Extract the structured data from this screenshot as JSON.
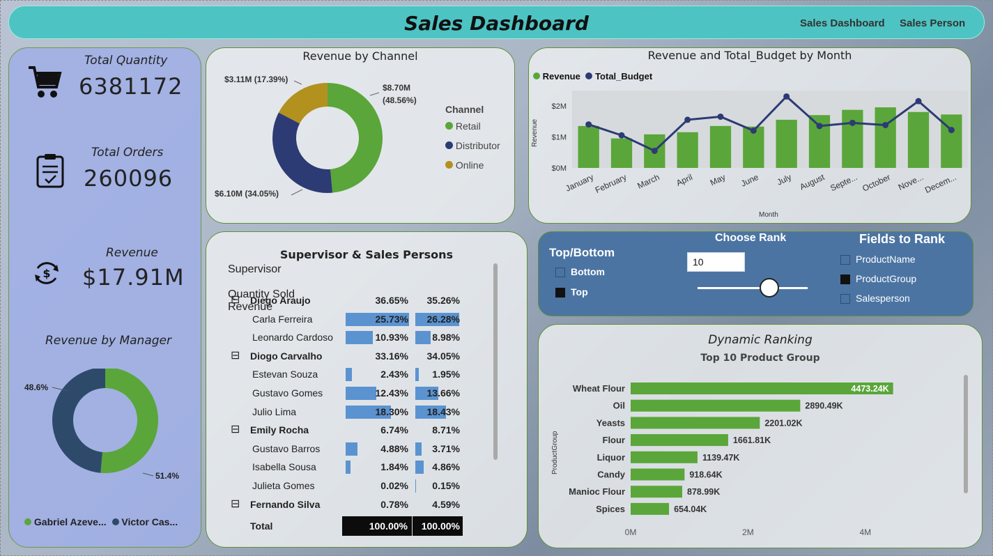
{
  "header": {
    "title": "Sales Dashboard",
    "nav": [
      "Sales Dashboard",
      "Sales Person"
    ]
  },
  "kpis": {
    "quantity_label": "Total Quantity",
    "quantity_value": "6381172",
    "orders_label": "Total Orders",
    "orders_value": "260096",
    "revenue_label": "Revenue",
    "revenue_value": "$17.91M"
  },
  "manager": {
    "title": "Revenue by Manager",
    "label_left": "48.6%",
    "label_right": "51.4%",
    "legend": [
      "Gabriel Azeve...",
      "Victor Cas..."
    ],
    "colors": [
      "#5aa63a",
      "#2e4a6b"
    ]
  },
  "channel": {
    "title": "Revenue by Channel",
    "legend_title": "Channel",
    "legend": [
      "Retail",
      "Distributor",
      "Online"
    ],
    "label_retail_1": "$8.70M",
    "label_retail_2": "(48.56%)",
    "label_distributor": "$6.10M (34.05%)",
    "label_online": "$3.11M (17.39%)",
    "colors": [
      "#5aa63a",
      "#2c3b74",
      "#b3911f"
    ]
  },
  "monthly": {
    "title": "Revenue and Total_Budget by Month",
    "legend": [
      "Revenue",
      "Total_Budget"
    ],
    "ylabel": "Revenue",
    "xlabel": "Month",
    "yticks": [
      "$2M",
      "$1M",
      "$0M"
    ],
    "months": [
      "January",
      "February",
      "March",
      "April",
      "May",
      "June",
      "July",
      "August",
      "Septe...",
      "October",
      "Nove...",
      "Decem..."
    ]
  },
  "table": {
    "title": "Supervisor & Sales Persons",
    "headers": [
      "Supervisor",
      "Quantity Sold",
      "Revenue"
    ],
    "rows": [
      {
        "name": "Diego Araujo",
        "qty": "36.65%",
        "rev": "35.26%",
        "group": true
      },
      {
        "name": "Carla Ferreira",
        "qty": "25.73%",
        "rev": "26.28%",
        "group": false
      },
      {
        "name": "Leonardo Cardoso",
        "qty": "10.93%",
        "rev": "8.98%",
        "group": false
      },
      {
        "name": "Diogo Carvalho",
        "qty": "33.16%",
        "rev": "34.05%",
        "group": true
      },
      {
        "name": "Estevan Souza",
        "qty": "2.43%",
        "rev": "1.95%",
        "group": false
      },
      {
        "name": "Gustavo Gomes",
        "qty": "12.43%",
        "rev": "13.66%",
        "group": false
      },
      {
        "name": "Julio Lima",
        "qty": "18.30%",
        "rev": "18.43%",
        "group": false
      },
      {
        "name": "Emily Rocha",
        "qty": "6.74%",
        "rev": "8.71%",
        "group": true
      },
      {
        "name": "Gustavo Barros",
        "qty": "4.88%",
        "rev": "3.71%",
        "group": false
      },
      {
        "name": "Isabella Sousa",
        "qty": "1.84%",
        "rev": "4.86%",
        "group": false
      },
      {
        "name": "Julieta Gomes",
        "qty": "0.02%",
        "rev": "0.15%",
        "group": false
      },
      {
        "name": "Fernando Silva",
        "qty": "0.78%",
        "rev": "4.59%",
        "group": true
      }
    ],
    "total_label": "Total",
    "total_qty": "100.00%",
    "total_rev": "100.00%",
    "expand_symbol": "⊟"
  },
  "rank": {
    "topbottom_title": "Top/Bottom",
    "opt_bottom": "Bottom",
    "opt_top": "Top",
    "choose_title": "Choose Rank",
    "rank_value": "10",
    "slider_fraction": 0.65,
    "fields_title": "Fields to Rank",
    "fields": [
      "ProductName",
      "ProductGroup",
      "Salesperson"
    ]
  },
  "ranking": {
    "title": "Dynamic Ranking",
    "subtitle": "Top 10 Product Group",
    "ylabel": "ProductGroup",
    "xticks": [
      "0M",
      "2M",
      "4M"
    ]
  },
  "chart_data": [
    {
      "type": "pie",
      "title": "Revenue by Manager",
      "categories": [
        "Gabriel Azeve...",
        "Victor Cas..."
      ],
      "values": [
        51.4,
        48.6
      ],
      "legend_position": "bottom"
    },
    {
      "type": "pie",
      "title": "Revenue by Channel",
      "categories": [
        "Retail",
        "Distributor",
        "Online"
      ],
      "values": [
        8.7,
        6.1,
        3.11
      ],
      "legend_position": "right"
    },
    {
      "type": "bar",
      "title": "Revenue and Total_Budget by Month",
      "categories": [
        "January",
        "February",
        "March",
        "April",
        "May",
        "June",
        "July",
        "August",
        "Septe...",
        "October",
        "Nove...",
        "Decem..."
      ],
      "series": [
        {
          "name": "Revenue",
          "type": "bar",
          "values": [
            1.35,
            0.95,
            1.08,
            1.15,
            1.35,
            1.33,
            1.55,
            1.7,
            1.87,
            1.95,
            1.8,
            1.72
          ]
        },
        {
          "name": "Total_Budget",
          "type": "line",
          "values": [
            1.4,
            1.05,
            0.55,
            1.55,
            1.65,
            1.2,
            2.3,
            1.35,
            1.45,
            1.38,
            2.15,
            1.22
          ]
        }
      ],
      "ylim": [
        0,
        2.4
      ],
      "xlabel": "Month",
      "ylabel": "Revenue",
      "legend_position": "top-left"
    },
    {
      "type": "bar",
      "orientation": "horizontal",
      "title": "Top 10 Product Group",
      "categories": [
        "Wheat Flour",
        "Oil",
        "Yeasts",
        "Flour",
        "Liquor",
        "Candy",
        "Manioc Flour",
        "Spices"
      ],
      "values": [
        4473.24,
        2890.49,
        2201.02,
        1661.81,
        1139.47,
        918.64,
        878.99,
        654.04
      ],
      "labels": [
        "4473.24K",
        "2890.49K",
        "2201.02K",
        "1661.81K",
        "1139.47K",
        "918.64K",
        "878.99K",
        "654.04K"
      ],
      "xlim": [
        0,
        5000
      ],
      "ylabel": "ProductGroup"
    }
  ]
}
